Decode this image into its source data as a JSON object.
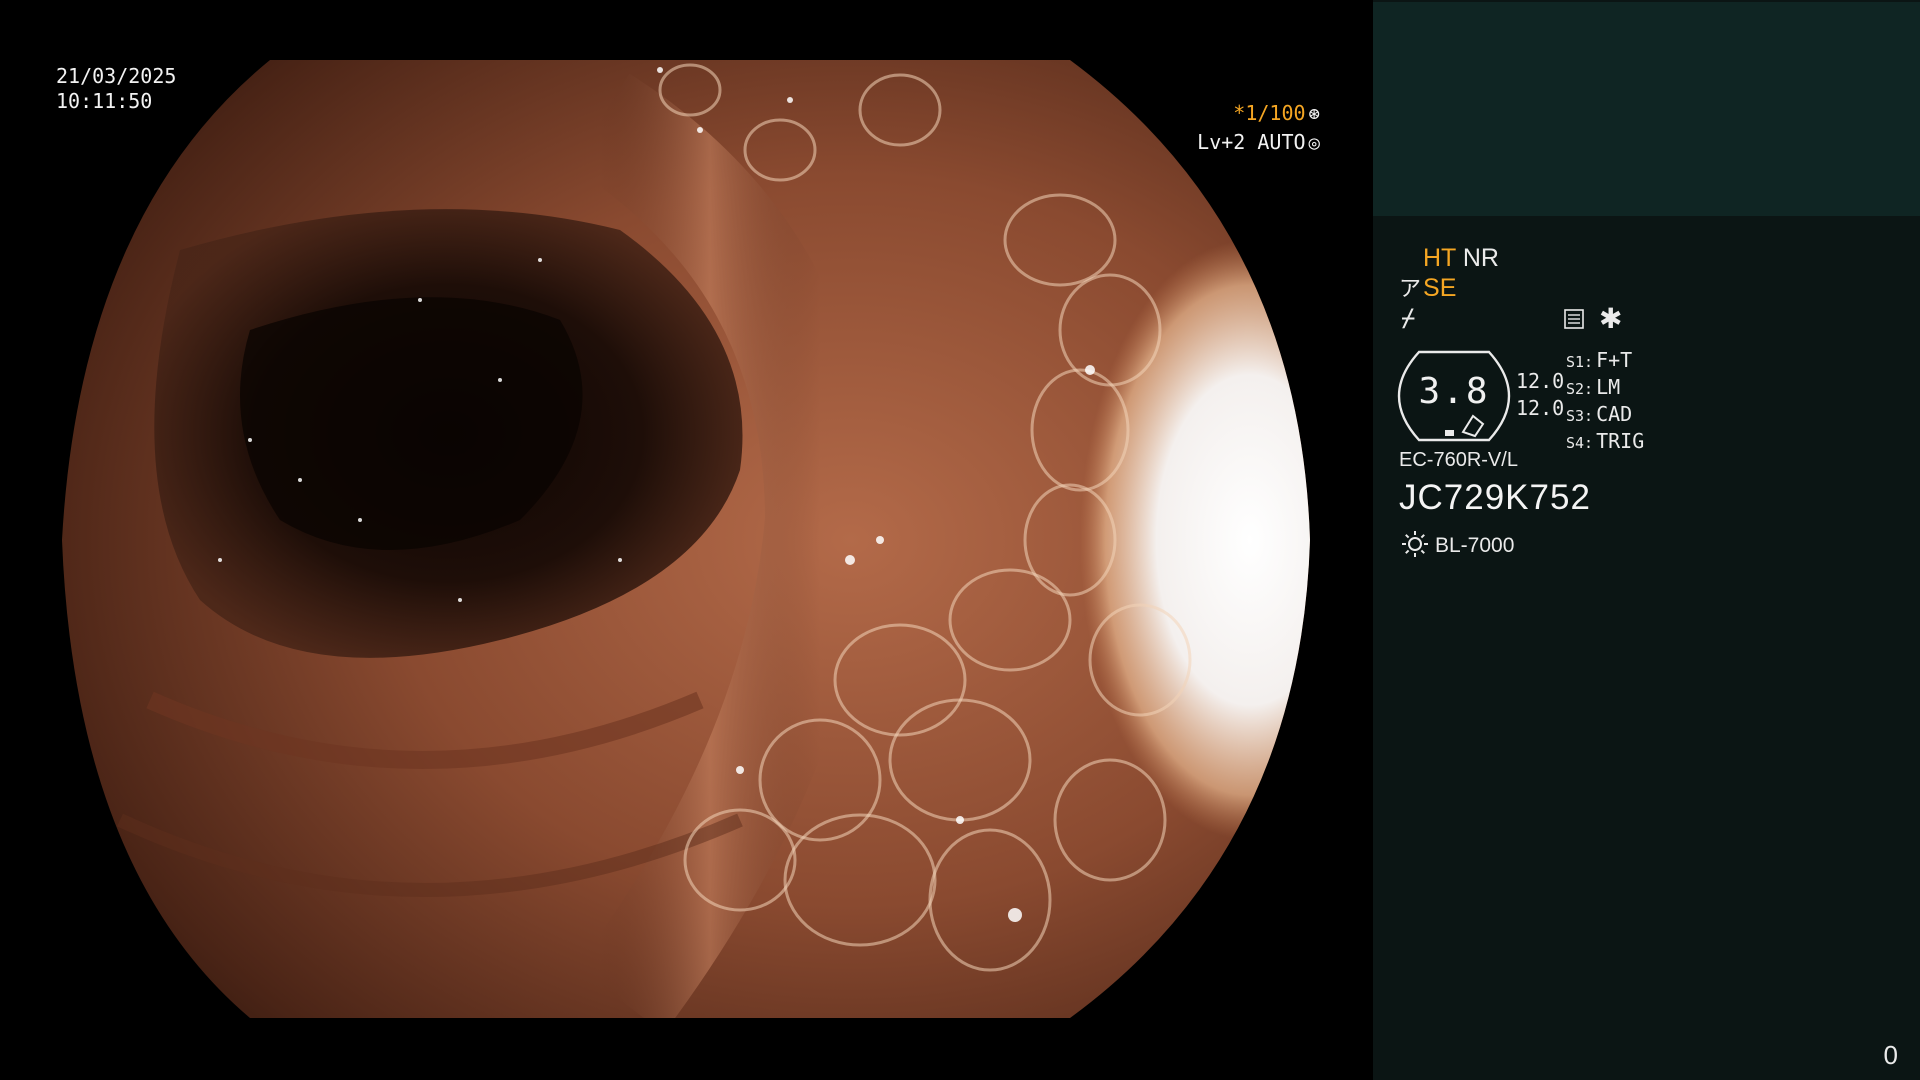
{
  "overlay": {
    "date": "21/03/2025",
    "time": "10:11:50",
    "shutter_speed": "*1/100",
    "iris_level": "Lv+2 AUTO"
  },
  "info_panel": {
    "mode_ht": "HT",
    "mode_nr": "NR",
    "structure_enhancement": "SE",
    "gauge_value": "3.8",
    "gauge_reading_1": "12.0",
    "gauge_reading_2": "12.0",
    "switches": [
      {
        "key": "S1:",
        "value": "F+T"
      },
      {
        "key": "S2:",
        "value": "LM"
      },
      {
        "key": "S3:",
        "value": "CAD"
      },
      {
        "key": "S4:",
        "value": "TRIG"
      }
    ],
    "scope_model": "EC-760R-V/L",
    "scope_serial": "JC729K752",
    "light_source": "BL-7000",
    "image_counter": "0"
  },
  "colors": {
    "accent": "#f5a623",
    "panel_background": "#0b1514",
    "panel_top_background": "#0f2523"
  },
  "icons": [
    "shutter-icon",
    "iris-icon",
    "scope-tip-icon",
    "freeze-icon",
    "memo-icon",
    "asterisk-icon",
    "light-source-icon"
  ]
}
